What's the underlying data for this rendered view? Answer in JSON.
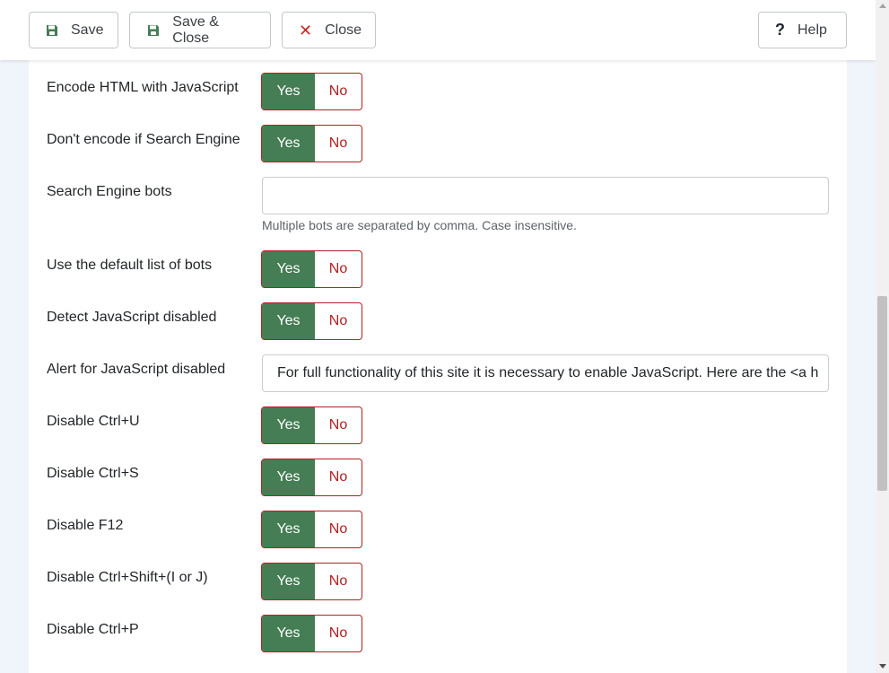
{
  "toolbar": {
    "save_label": "Save",
    "save_close_label": "Save & Close",
    "close_label": "Close",
    "help_label": "Help",
    "help_glyph": "?",
    "close_glyph": "✕"
  },
  "form": {
    "encode_html": {
      "label": "Encode HTML with JavaScript",
      "yes": "Yes",
      "no": "No"
    },
    "dont_encode_search": {
      "label": "Don't encode if Search Engine",
      "yes": "Yes",
      "no": "No"
    },
    "search_bots": {
      "label": "Search Engine bots",
      "value": "",
      "help": "Multiple bots are separated by comma. Case insensitive."
    },
    "default_bots": {
      "label": "Use the default list of bots",
      "yes": "Yes",
      "no": "No"
    },
    "detect_js": {
      "label": "Detect JavaScript disabled",
      "yes": "Yes",
      "no": "No"
    },
    "alert_js": {
      "label": "Alert for JavaScript disabled",
      "value": "For full functionality of this site it is necessary to enable JavaScript. Here are the <a h"
    },
    "ctrl_u": {
      "label": "Disable Ctrl+U",
      "yes": "Yes",
      "no": "No"
    },
    "ctrl_s": {
      "label": "Disable Ctrl+S",
      "yes": "Yes",
      "no": "No"
    },
    "f12": {
      "label": "Disable F12",
      "yes": "Yes",
      "no": "No"
    },
    "ctrl_shift": {
      "label": "Disable Ctrl+Shift+(I or J)",
      "yes": "Yes",
      "no": "No"
    },
    "ctrl_p": {
      "label": "Disable Ctrl+P",
      "yes": "Yes",
      "no": "No"
    }
  },
  "colors": {
    "yes_active_bg": "#457d54",
    "no_text": "#b32121",
    "close_icon": "#c52827"
  },
  "icons": {
    "save": "floppy-disk-icon",
    "close": "close-icon",
    "help": "question-icon"
  }
}
